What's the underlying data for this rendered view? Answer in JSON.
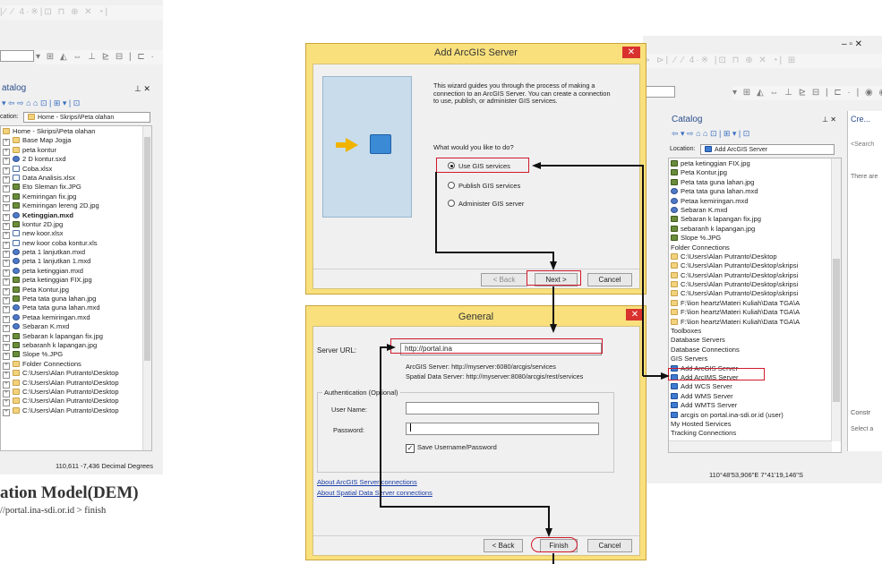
{
  "left_window": {
    "toolbar_glyphs": "|⁄ ⁄ 4·※|⊡ ⊓ ⊕ ✕ ◔|",
    "toolbar2_glyphs": "▾ ⊞ ◭ ⇔ ⊥ ⊵ ⊟ | ⊏ ·",
    "panel_title": "atalog",
    "pin": "⊥ ✕",
    "nav_glyphs": "▾ ⇦ ⇨ ⌂ ⌂ ⊡ | ⊞ ▾ | ⊡",
    "location_label": "cation:",
    "location_value": "Home - Skripsi\\Peta olahan",
    "items": [
      {
        "label": "Home - Skripsi\\Peta olahan",
        "icon": "folder-icon",
        "bold": false
      },
      {
        "label": "Base Map Jogja",
        "icon": "folder-icon",
        "bold": false
      },
      {
        "label": "peta kontur",
        "icon": "folder-icon",
        "bold": false
      },
      {
        "label": "2 D kontur.sxd",
        "icon": "map-doc-icon",
        "bold": false
      },
      {
        "label": "Coba.xlsx",
        "icon": "table-icon",
        "bold": false
      },
      {
        "label": "Data Analisis.xlsx",
        "icon": "table-icon",
        "bold": false
      },
      {
        "label": "Eto Sleman fix.JPG",
        "icon": "raster-icon",
        "bold": false
      },
      {
        "label": "Kemiringan fix.jpg",
        "icon": "raster-icon",
        "bold": false
      },
      {
        "label": "Kemiringan lereng 2D.jpg",
        "icon": "raster-icon",
        "bold": false
      },
      {
        "label": "Ketinggian.mxd",
        "icon": "map-doc-icon",
        "bold": true
      },
      {
        "label": "kontur 2D.jpg",
        "icon": "raster-icon",
        "bold": false
      },
      {
        "label": "new koor.xlsx",
        "icon": "table-icon",
        "bold": false
      },
      {
        "label": "new koor coba kontur.xls",
        "icon": "table-icon",
        "bold": false
      },
      {
        "label": "peta 1 lanjutkan.mxd",
        "icon": "map-doc-icon",
        "bold": false
      },
      {
        "label": "peta 1 lanjutkan 1.mxd",
        "icon": "map-doc-icon",
        "bold": false
      },
      {
        "label": "peta ketinggian.mxd",
        "icon": "map-doc-icon",
        "bold": false
      },
      {
        "label": "peta ketinggian FIX.jpg",
        "icon": "raster-icon",
        "bold": false
      },
      {
        "label": "Peta Kontur.jpg",
        "icon": "raster-icon",
        "bold": false
      },
      {
        "label": "Peta tata guna lahan.jpg",
        "icon": "raster-icon",
        "bold": false
      },
      {
        "label": "Peta tata guna lahan.mxd",
        "icon": "map-doc-icon",
        "bold": false
      },
      {
        "label": "Petaa kemiringan.mxd",
        "icon": "map-doc-icon",
        "bold": false
      },
      {
        "label": "Sebaran K.mxd",
        "icon": "map-doc-icon",
        "bold": false
      },
      {
        "label": "Sebaran k lapangan fix.jpg",
        "icon": "raster-icon",
        "bold": false
      },
      {
        "label": "sebaranh k lapangan.jpg",
        "icon": "raster-icon",
        "bold": false
      },
      {
        "label": "Slope %.JPG",
        "icon": "raster-icon",
        "bold": false
      },
      {
        "label": "Folder Connections",
        "icon": "folder-icon",
        "bold": false
      },
      {
        "label": "C:\\Users\\Alan Putranto\\Desktop",
        "icon": "folder-icon",
        "bold": false
      },
      {
        "label": "C:\\Users\\Alan Putranto\\Desktop",
        "icon": "folder-icon",
        "bold": false
      },
      {
        "label": "C:\\Users\\Alan Putranto\\Desktop",
        "icon": "folder-icon",
        "bold": false
      },
      {
        "label": "C:\\Users\\Alan Putranto\\Desktop",
        "icon": "folder-icon",
        "bold": false
      },
      {
        "label": "C:\\Users\\Alan Putranto\\Desktop",
        "icon": "folder-icon",
        "bold": false
      }
    ],
    "status_coords": "110,611  -7,436 Decimal Degrees"
  },
  "caption": {
    "heading": "ation Model(DEM)",
    "line": "//portal.ina-sdi.or.id > finish"
  },
  "wizard_dialog": {
    "title": "Add ArcGIS Server",
    "close": "✕",
    "intro": "This wizard guides you through the process of making a connection to an ArcGIS Server.  You can create a connection to use, publish, or administer GIS services.",
    "question": "What would you like to do?",
    "options": [
      {
        "label": "Use GIS services",
        "selected": true
      },
      {
        "label": "Publish GIS services",
        "selected": false
      },
      {
        "label": "Administer GIS server",
        "selected": false
      }
    ],
    "back": "< Back",
    "next": "Next >",
    "cancel": "Cancel"
  },
  "general_dialog": {
    "title": "General",
    "close": "✕",
    "server_url_label": "Server URL:",
    "server_url_value": "http://portal.ina",
    "hint1": "ArcGIS Server: http://myserver:6080/arcgis/services",
    "hint2": "Spatial Data Server: http://myserver:8080/arcgis/rest/services",
    "auth_label": "Authentication (Optional)",
    "user_label": "User Name:",
    "password_label": "Password:",
    "save_label": "Save Username/Password",
    "link1": "About ArcGIS Server connections",
    "link2": "About Spatial Data Server connections",
    "back": "< Back",
    "finish": "Finish",
    "cancel": "Cancel"
  },
  "right_window": {
    "window_controls": "–  ▫  ✕",
    "toolbar_glyphs": "⊳ ⊳| ⁄ ⁄ 4·※ |⊡ ⊓ ⊕ ✕ ◔| ⊞",
    "toolbar2_glyphs": "▾ ⊞ ◭ ⇔ ⊥ ⊵ ⊟ | ⊏ · | ◉ ◉",
    "panel_title": "Catalog",
    "pin": "⊥ ✕",
    "nav_glyphs": "⇦ ▾ ⇨ ⌂ ⌂ ⊡ | ⊞ ▾ | ⊡",
    "location_label": "Location:",
    "location_value": "Add ArcGIS Server",
    "items": [
      {
        "label": "peta ketinggian FIX.jpg",
        "icon": "raster-icon"
      },
      {
        "label": "Peta Kontur.jpg",
        "icon": "raster-icon"
      },
      {
        "label": "Peta tata guna lahan.jpg",
        "icon": "raster-icon"
      },
      {
        "label": "Peta tata guna lahan.mxd",
        "icon": "map-doc-icon"
      },
      {
        "label": "Petaa kemiringan.mxd",
        "icon": "map-doc-icon"
      },
      {
        "label": "Sebaran K.mxd",
        "icon": "map-doc-icon"
      },
      {
        "label": "Sebaran k lapangan fix.jpg",
        "icon": "raster-icon"
      },
      {
        "label": "sebaranh k lapangan.jpg",
        "icon": "raster-icon"
      },
      {
        "label": "Slope %.JPG",
        "icon": "raster-icon"
      },
      {
        "label": "Folder Connections",
        "icon": "none"
      },
      {
        "label": "C:\\Users\\Alan Putranto\\Desktop",
        "icon": "folder-icon"
      },
      {
        "label": "C:\\Users\\Alan Putranto\\Desktop\\skripsi",
        "icon": "folder-icon"
      },
      {
        "label": "C:\\Users\\Alan Putranto\\Desktop\\skripsi",
        "icon": "folder-icon"
      },
      {
        "label": "C:\\Users\\Alan Putranto\\Desktop\\skripsi",
        "icon": "folder-icon"
      },
      {
        "label": "C:\\Users\\Alan Putranto\\Desktop\\skripsi",
        "icon": "folder-icon"
      },
      {
        "label": "F:\\lion heartz\\Materi Kuliah\\Data TGA\\A",
        "icon": "folder-icon"
      },
      {
        "label": "F:\\lion heartz\\Materi Kuliah\\Data TGA\\A",
        "icon": "folder-icon"
      },
      {
        "label": "F:\\lion heartz\\Materi Kuliah\\Data TGA\\A",
        "icon": "folder-icon"
      },
      {
        "label": "Toolboxes",
        "icon": "none"
      },
      {
        "label": "Database Servers",
        "icon": "none"
      },
      {
        "label": "Database Connections",
        "icon": "none"
      },
      {
        "label": "GIS Servers",
        "icon": "none"
      },
      {
        "label": "Add ArcGIS Server",
        "icon": "server-icon"
      },
      {
        "label": "Add ArcIMS Server",
        "icon": "server-icon"
      },
      {
        "label": "Add WCS Server",
        "icon": "server-icon"
      },
      {
        "label": "Add WMS Server",
        "icon": "server-icon"
      },
      {
        "label": "Add WMTS Server",
        "icon": "server-icon"
      },
      {
        "label": "arcgis on portal.ina-sdi.or.id (user)",
        "icon": "server-icon"
      },
      {
        "label": "My Hosted Services",
        "icon": "none"
      },
      {
        "label": "Tracking Connections",
        "icon": "none"
      }
    ],
    "status_coords": "110°48'53,906\"E  7°41'19,146\"S",
    "side_panel_title": "Cre...",
    "side_search": "<Search",
    "side_text": "There are",
    "side_construct": "Constr",
    "side_select": "Select a"
  },
  "colors": {
    "dialog_frame": "#f9e07d",
    "close_red": "#d9322e",
    "highlight_red": "#d0192b",
    "link_blue": "#1a3ea8"
  }
}
